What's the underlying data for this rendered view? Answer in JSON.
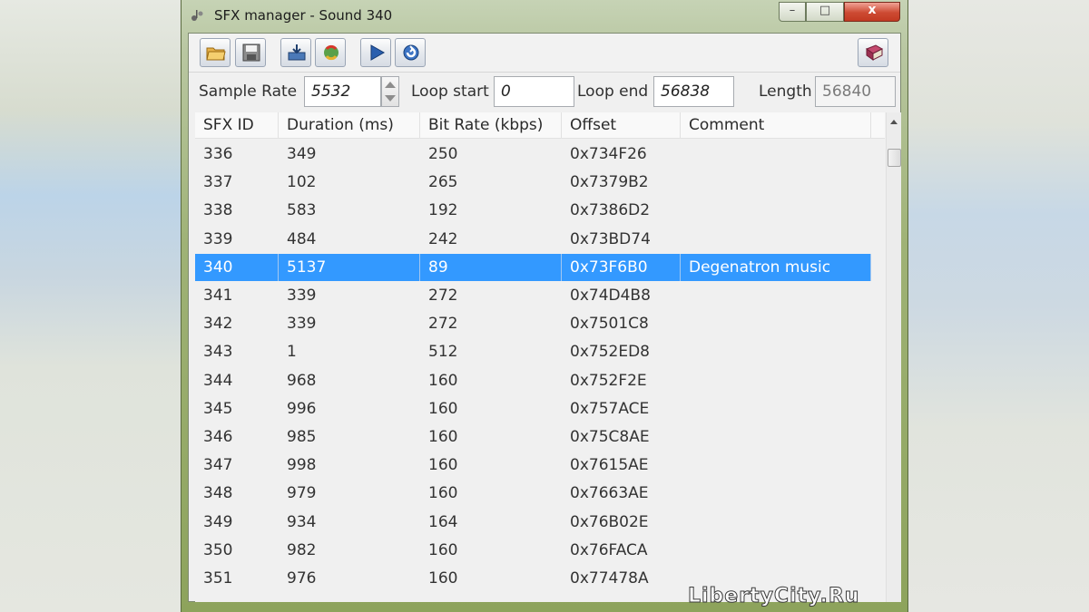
{
  "window": {
    "title": "SFX manager - Sound 340",
    "controls": {
      "minimize": "–",
      "maximize": "□",
      "close": "x"
    }
  },
  "toolbar": {
    "buttons": [
      {
        "name": "open-icon"
      },
      {
        "name": "save-icon"
      },
      {
        "name": "import-icon"
      },
      {
        "name": "export-icon"
      },
      {
        "name": "play-icon"
      },
      {
        "name": "refresh-icon"
      },
      {
        "name": "help-book-icon"
      }
    ]
  },
  "params": {
    "sample_rate_label": "Sample Rate",
    "sample_rate_value": "5532",
    "loop_start_label": "Loop start",
    "loop_start_value": "0",
    "loop_end_label": "Loop end",
    "loop_end_value": "56838",
    "length_label": "Length",
    "length_value": "56840"
  },
  "table": {
    "columns": [
      "SFX ID",
      "Duration (ms)",
      "Bit Rate (kbps)",
      "Offset",
      "Comment"
    ],
    "rows": [
      [
        "336",
        "349",
        "250",
        "0x734F26",
        ""
      ],
      [
        "337",
        "102",
        "265",
        "0x7379B2",
        ""
      ],
      [
        "338",
        "583",
        "192",
        "0x7386D2",
        ""
      ],
      [
        "339",
        "484",
        "242",
        "0x73BD74",
        ""
      ],
      [
        "340",
        "5137",
        "89",
        "0x73F6B0",
        "Degenatron music"
      ],
      [
        "341",
        "339",
        "272",
        "0x74D4B8",
        ""
      ],
      [
        "342",
        "339",
        "272",
        "0x7501C8",
        ""
      ],
      [
        "343",
        "1",
        "512",
        "0x752ED8",
        ""
      ],
      [
        "344",
        "968",
        "160",
        "0x752F2E",
        ""
      ],
      [
        "345",
        "996",
        "160",
        "0x757ACE",
        ""
      ],
      [
        "346",
        "985",
        "160",
        "0x75C8AE",
        ""
      ],
      [
        "347",
        "998",
        "160",
        "0x7615AE",
        ""
      ],
      [
        "348",
        "979",
        "160",
        "0x7663AE",
        ""
      ],
      [
        "349",
        "934",
        "164",
        "0x76B02E",
        ""
      ],
      [
        "350",
        "982",
        "160",
        "0x76FACA",
        ""
      ],
      [
        "351",
        "976",
        "160",
        "0x77478A",
        ""
      ]
    ],
    "selected_row_id": "340"
  },
  "watermark": "LibertyCity.Ru",
  "colors": {
    "selection": "#3399ff",
    "close_button": "#cd4a33"
  }
}
